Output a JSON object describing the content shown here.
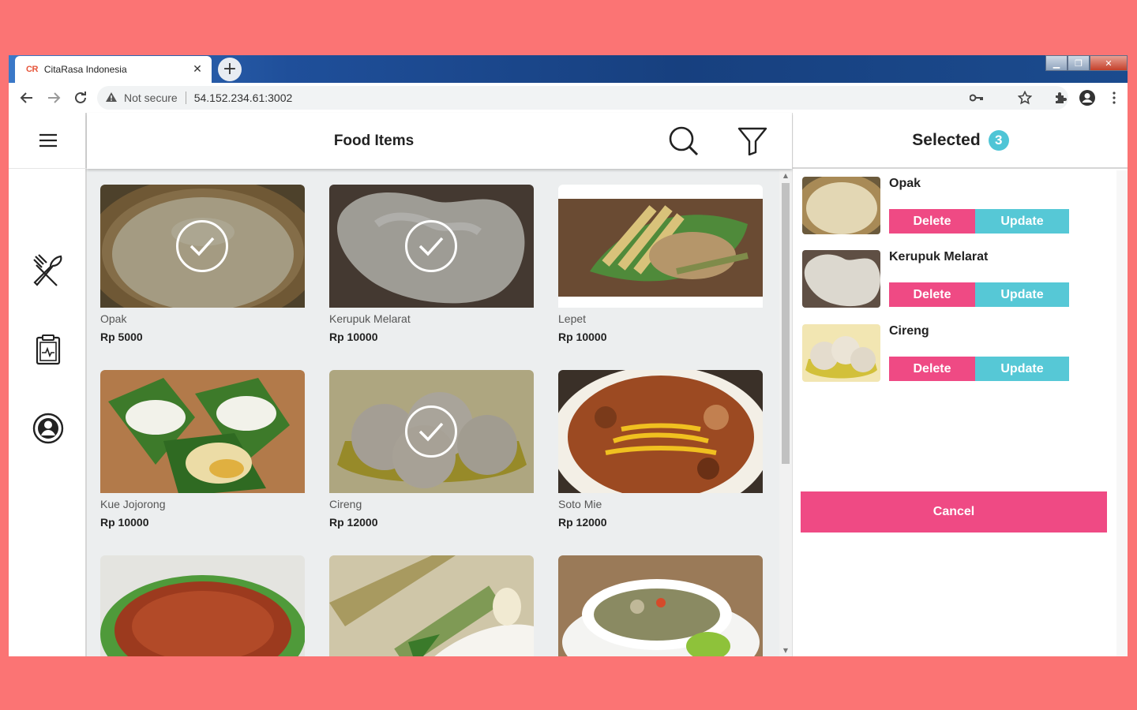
{
  "browser": {
    "tab_logo": "CR",
    "tab_title": "CitaRasa Indonesia",
    "security_label": "Not secure",
    "url": "54.152.234.61:3002"
  },
  "header": {
    "title": "Food Items"
  },
  "foods": [
    {
      "name": "Opak",
      "price": "Rp 5000",
      "selected": true
    },
    {
      "name": "Kerupuk Melarat",
      "price": "Rp 10000",
      "selected": true
    },
    {
      "name": "Lepet",
      "price": "Rp 10000",
      "selected": false
    },
    {
      "name": "Kue Jojorong",
      "price": "Rp 10000",
      "selected": false
    },
    {
      "name": "Cireng",
      "price": "Rp 12000",
      "selected": true
    },
    {
      "name": "Soto Mie",
      "price": "Rp 12000",
      "selected": false
    },
    {
      "name": "",
      "price": "",
      "selected": false
    },
    {
      "name": "",
      "price": "",
      "selected": false
    },
    {
      "name": "",
      "price": "",
      "selected": false
    }
  ],
  "panel": {
    "title": "Selected",
    "count": "3",
    "items": [
      {
        "name": "Opak"
      },
      {
        "name": "Kerupuk Melarat"
      },
      {
        "name": "Cireng"
      }
    ],
    "delete_label": "Delete",
    "update_label": "Update",
    "cancel_label": "Cancel"
  },
  "colors": {
    "background": "#fb7474",
    "accent_pink": "#ef4a84",
    "accent_teal": "#56c8d6"
  }
}
